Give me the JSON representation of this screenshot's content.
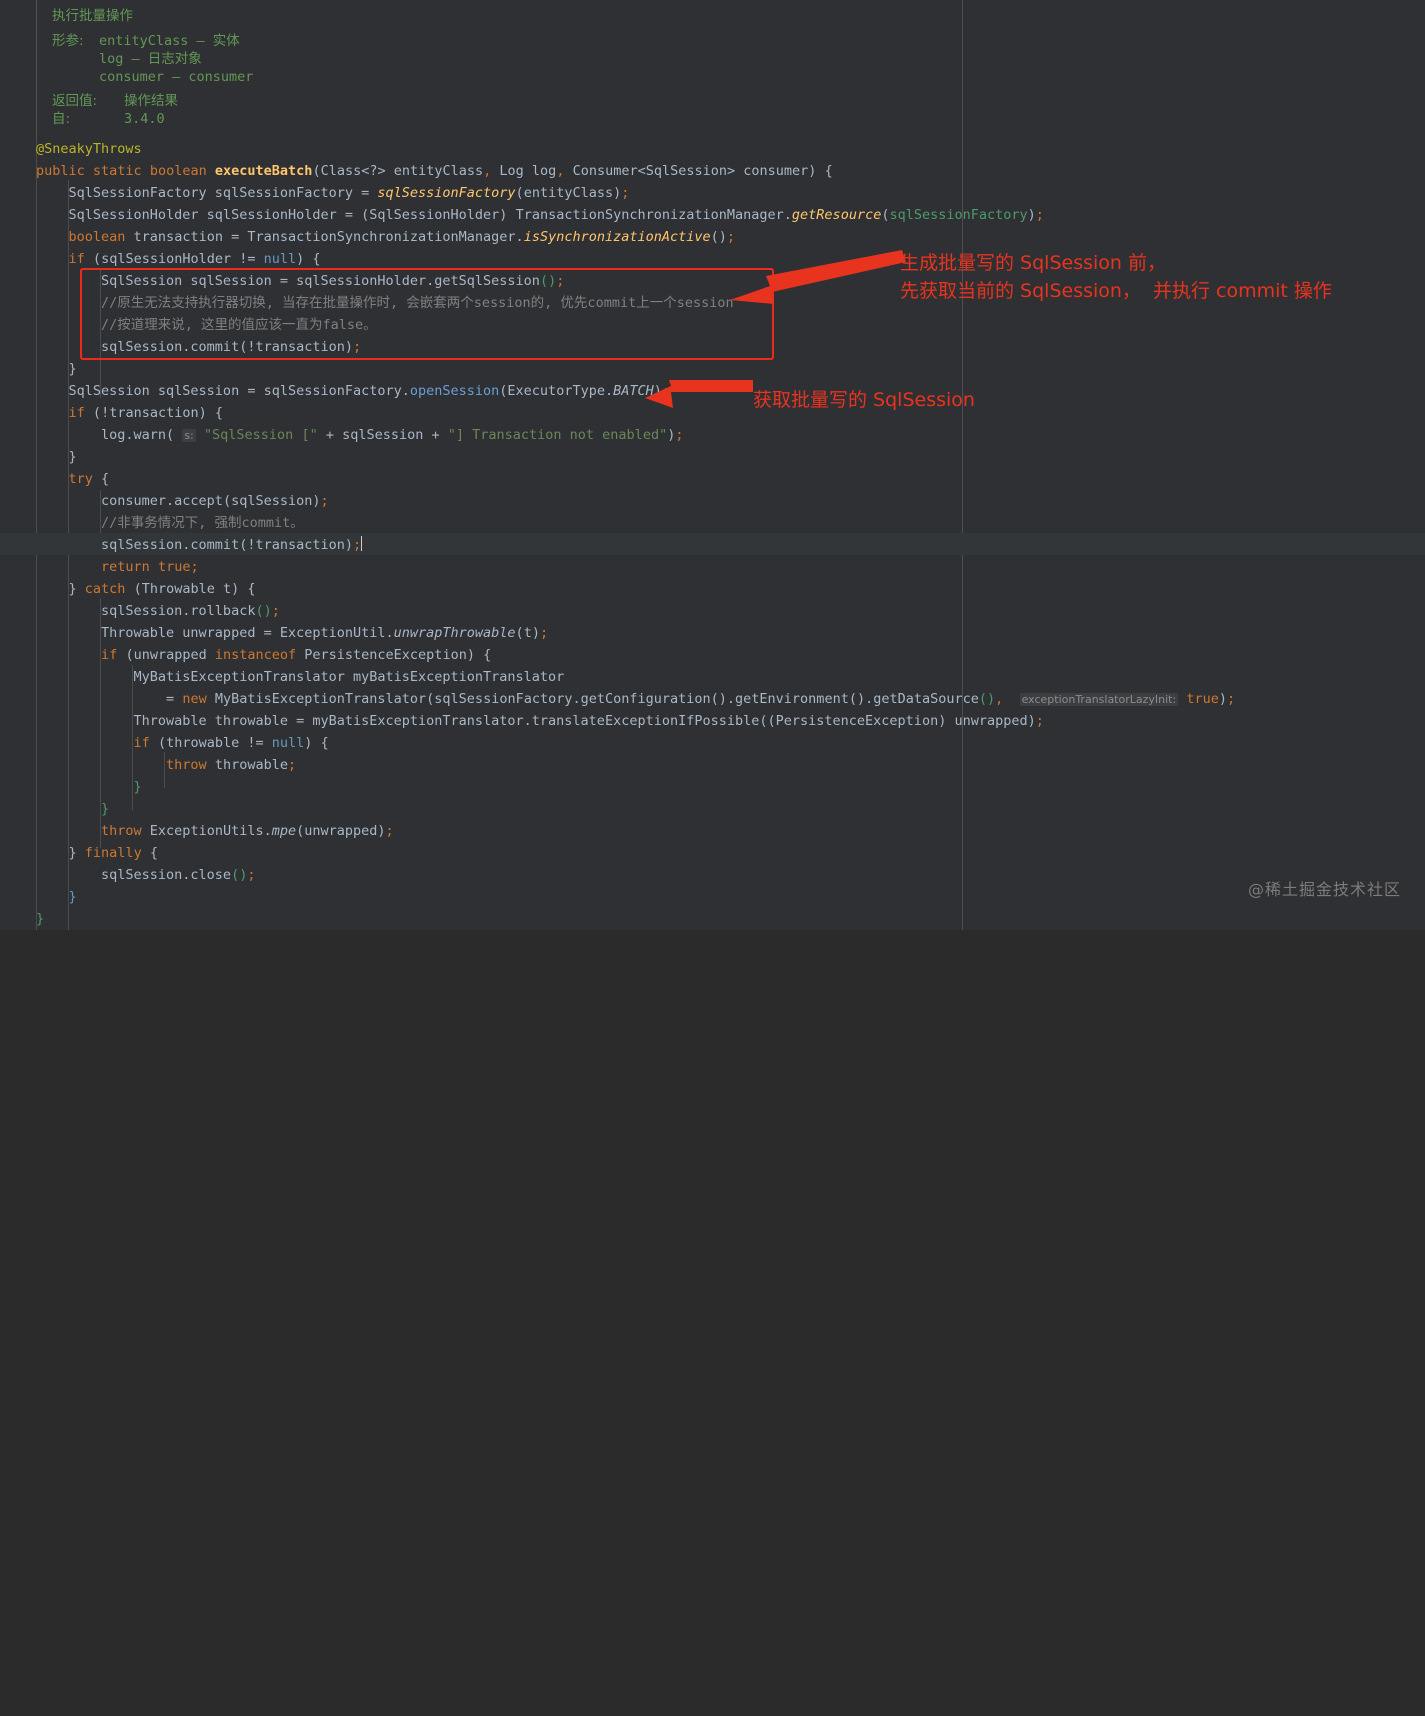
{
  "editor": {
    "background": "#2f3033",
    "foreground": "#a9b7c6",
    "current_line_highlight": "#323639",
    "annotation_color": "#e8331f",
    "doc_comment_color": "#629755"
  },
  "doc_comment": {
    "lines": [
      {
        "text": "执行批量操作",
        "indent": 0
      },
      {
        "text": "形参:    entityClass – 实体",
        "indent": 0
      },
      {
        "text": "             log – 日志对象",
        "indent": 0
      },
      {
        "text": "             consumer – consumer",
        "indent": 0
      },
      {
        "text": "返回值: 操作结果",
        "indent": 0
      },
      {
        "text": "自:        3.4.0",
        "indent": 0
      }
    ],
    "label_params": "形参:",
    "label_returns": "返回值:",
    "label_since": "自:",
    "summary": "执行批量操作",
    "param_entity": "entityClass – 实体",
    "param_log": "log – 日志对象",
    "param_consumer": "consumer – consumer",
    "returns": "操作结果",
    "since": "3.4.0"
  },
  "code": {
    "annotation": "@SneakyThrows",
    "lines": [
      "public static boolean executeBatch(Class<?> entityClass, Log log, Consumer<SqlSession> consumer) {",
      "    SqlSessionFactory sqlSessionFactory = sqlSessionFactory(entityClass);",
      "    SqlSessionHolder sqlSessionHolder = (SqlSessionHolder) TransactionSynchronizationManager.getResource(sqlSessionFactory);",
      "    boolean transaction = TransactionSynchronizationManager.isSynchronizationActive();",
      "    if (sqlSessionHolder != null) {",
      "        SqlSession sqlSession = sqlSessionHolder.getSqlSession();",
      "        //原生无法支持执行器切换, 当存在批量操作时, 会嵌套两个session的, 优先commit上一个session",
      "        //按道理来说, 这里的值应该一直为false。",
      "        sqlSession.commit(!transaction);",
      "    }",
      "    SqlSession sqlSession = sqlSessionFactory.openSession(ExecutorType.BATCH);",
      "    if (!transaction) {",
      "        log.warn( s: \"SqlSession [\" + sqlSession + \"] Transaction not enabled\");",
      "    }",
      "    try {",
      "        consumer.accept(sqlSession);",
      "        //非事务情况下, 强制commit。",
      "        sqlSession.commit(!transaction);",
      "        return true;",
      "    } catch (Throwable t) {",
      "        sqlSession.rollback();",
      "        Throwable unwrapped = ExceptionUtil.unwrapThrowable(t);",
      "        if (unwrapped instanceof PersistenceException) {",
      "            MyBatisExceptionTranslator myBatisExceptionTranslator",
      "                = new MyBatisExceptionTranslator(sqlSessionFactory.getConfiguration().getEnvironment().getDataSource(),  exceptionTranslatorLazyInit: true);",
      "            Throwable throwable = myBatisExceptionTranslator.translateExceptionIfPossible((PersistenceException) unwrapped);",
      "            if (throwable != null) {",
      "                throw throwable;",
      "            }",
      "        }",
      "        throw ExceptionUtils.mpe(unwrapped);",
      "    } finally {",
      "        sqlSession.close();",
      "    }",
      "}"
    ],
    "param_hint_s": "s:",
    "param_hint_lazyinit": "exceptionTranslatorLazyInit:"
  },
  "annotations": {
    "box_note_line1": "生成批量写的 SqlSession 前，",
    "box_note_line2": "先获取当前的 SqlSession，  并执行 commit 操作",
    "arrow_note": "获取批量写的 SqlSession"
  },
  "watermark": "@稀土掘金技术社区"
}
